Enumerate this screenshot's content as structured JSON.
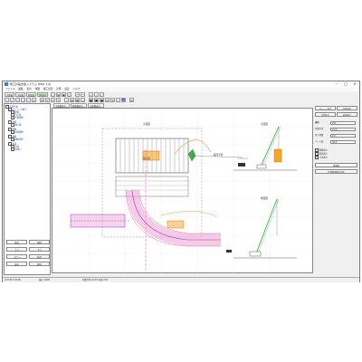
{
  "window": {
    "title": "施工計画支援システム [PRO 3.0]",
    "controls": {
      "minimize": "–",
      "maximize": "□",
      "close": "×"
    }
  },
  "menu": [
    "ファイル",
    "編集",
    "表示",
    "作図",
    "施工計画",
    "計算",
    "設定",
    "ヘルプ"
  ],
  "tabs": [
    {
      "label": "全体図"
    },
    {
      "label": "平面図"
    },
    {
      "label": "側面図"
    },
    {
      "label": "3D表示",
      "active": true
    }
  ],
  "canvas_buttons": [
    "平面図表示",
    "側面図表示",
    "正面図表示"
  ],
  "tree": [
    {
      "label": "作業計画",
      "level": 0
    },
    {
      "label": "クレーン計画 1",
      "level": 1
    },
    {
      "label": "配置",
      "level": 2
    },
    {
      "label": "吊り荷",
      "level": 2
    },
    {
      "label": "作業範囲",
      "level": 2
    },
    {
      "label": "道路",
      "level": 1
    },
    {
      "label": "搬入路",
      "level": 2
    },
    {
      "label": "建物",
      "level": 1
    },
    {
      "label": "既設建物",
      "level": 2
    },
    {
      "label": "敷地",
      "level": 1
    },
    {
      "label": "敷地境界",
      "level": 2
    },
    {
      "label": "仮設",
      "level": 1
    },
    {
      "label": "足場",
      "level": 2
    },
    {
      "label": "仮囲い",
      "level": 2
    }
  ],
  "left_buttons": [
    "追加",
    "削除",
    "上へ",
    "下へ",
    "コピー",
    "貼付",
    "読込",
    "保存"
  ],
  "right_panel": {
    "top_buttons": [
      "クレーン設定",
      "吊荷設定",
      "計算実行",
      "結果表示"
    ],
    "section_labels": [
      "機種",
      "作業半径",
      "吊り荷重",
      "ブーム長"
    ],
    "inputs": [
      "25t",
      "12.0",
      "2.5",
      "30.5"
    ],
    "checkboxes": [
      "範囲表示",
      "旋回表示",
      "寸法表示"
    ],
    "bottom_buttons": [
      "再描画",
      "作業範囲図を作成"
    ]
  },
  "drawing": {
    "labels": [
      "平面図",
      "立面図",
      "側面図",
      "旋回半径",
      "吊り荷"
    ]
  },
  "status": [
    "X=0.00  Y=0.00",
    "縮尺 1/100",
    "作業半径 12.0m  吊荷 2.5t"
  ]
}
